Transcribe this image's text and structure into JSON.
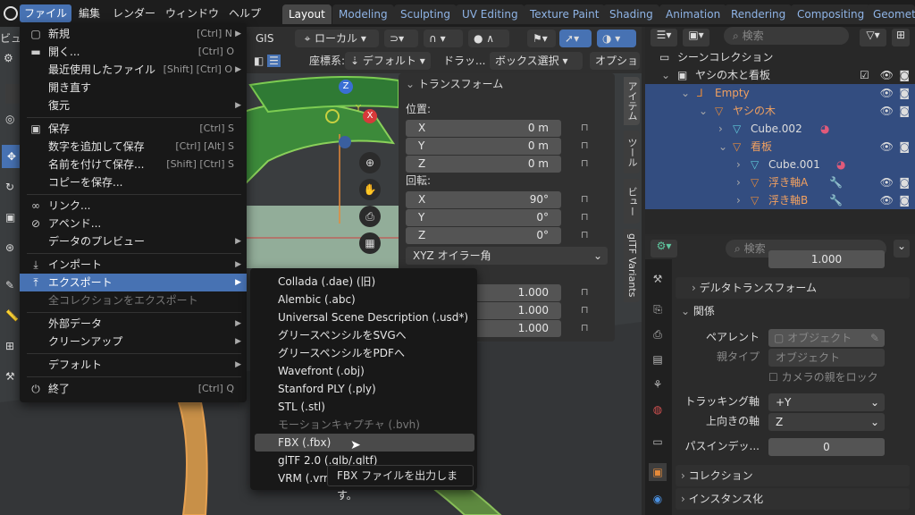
{
  "menubar": {
    "app_label": "",
    "items": [
      "ファイル",
      "編集",
      "レンダー",
      "ウィンドウ",
      "ヘルプ"
    ]
  },
  "workspaces": [
    "Layout",
    "Modeling",
    "Sculpting",
    "UV Editing",
    "Texture Paint",
    "Shading",
    "Animation",
    "Rendering",
    "Compositing",
    "Geometr"
  ],
  "viewport": {
    "header1": {
      "gis": "GIS",
      "orientation": "ローカル"
    },
    "header2": {
      "coord_label": "座標系:",
      "coord_value": "デフォルト",
      "drag_label": "ドラッ...",
      "select_mode": "ボックス選択",
      "options": "オプショ"
    },
    "left_label": "ビュ",
    "gizmo": {
      "z": "Z",
      "y": "Y",
      "x": "X"
    }
  },
  "npanel": {
    "title": "トランスフォーム",
    "location_label": "位置:",
    "location": [
      {
        "axis": "X",
        "value": "0 m"
      },
      {
        "axis": "Y",
        "value": "0 m"
      },
      {
        "axis": "Z",
        "value": "0 m"
      }
    ],
    "rotation_label": "回転:",
    "rotation": [
      {
        "axis": "X",
        "value": "90°"
      },
      {
        "axis": "Y",
        "value": "0°"
      },
      {
        "axis": "Z",
        "value": "0°"
      }
    ],
    "rotation_mode": "XYZ オイラー角",
    "scale": [
      "1.000",
      "1.000",
      "1.000"
    ],
    "tabs": [
      "アイテム",
      "ツール",
      "ビュー",
      "glTF Variants"
    ]
  },
  "file_menu": [
    {
      "label": "新規",
      "shortcut": "[Ctrl] N",
      "arrow": true
    },
    {
      "label": "開く...",
      "shortcut": "[Ctrl] O"
    },
    {
      "label": "最近使用したファイル",
      "shortcut": "[Shift] [Ctrl] O",
      "arrow": true
    },
    {
      "label": "開き直す",
      "shortcut": ""
    },
    {
      "label": "復元",
      "shortcut": "",
      "arrow": true
    },
    {
      "label": "保存",
      "shortcut": "[Ctrl] S"
    },
    {
      "label": "数字を追加して保存",
      "shortcut": "[Ctrl] [Alt] S"
    },
    {
      "label": "名前を付けて保存...",
      "shortcut": "[Shift] [Ctrl] S"
    },
    {
      "label": "コピーを保存...",
      "shortcut": ""
    },
    {
      "label": "リンク...",
      "shortcut": ""
    },
    {
      "label": "アペンド...",
      "shortcut": ""
    },
    {
      "label": "データのプレビュー",
      "shortcut": "",
      "arrow": true
    },
    {
      "label": "インポート",
      "shortcut": "",
      "arrow": true
    },
    {
      "label": "エクスポート",
      "shortcut": "",
      "arrow": true
    },
    {
      "label": "全コレクションをエクスポート",
      "shortcut": ""
    },
    {
      "label": "外部データ",
      "shortcut": "",
      "arrow": true
    },
    {
      "label": "クリーンアップ",
      "shortcut": "",
      "arrow": true
    },
    {
      "label": "デフォルト",
      "shortcut": "",
      "arrow": true
    },
    {
      "label": "終了",
      "shortcut": "[Ctrl] Q"
    }
  ],
  "export_menu": [
    "Collada (.dae) (旧)",
    "Alembic (.abc)",
    "Universal Scene Description (.usd*)",
    "グリースペンシルをSVGへ",
    "グリースペンシルをPDFへ",
    "Wavefront (.obj)",
    "Stanford PLY (.ply)",
    "STL (.stl)",
    "モーションキャプチャ (.bvh)",
    "FBX (.fbx)",
    "glTF 2.0 (.glb/.gltf)",
    "VRM (.vrm"
  ],
  "tooltip": "FBX ファイルを出力します。",
  "outliner": {
    "search_placeholder": "検索",
    "rows": [
      "シーンコレクション",
      "ヤシの木と看板",
      "Empty",
      "ヤシの木",
      "Cube.002",
      "看板",
      "Cube.001",
      "浮き軸A",
      "浮き軸B"
    ]
  },
  "properties": {
    "search_placeholder": "検索",
    "top_value": "1.000",
    "delta_transform": "デルタトランスフォーム",
    "relations": "関係",
    "parent_label": "ペアレント",
    "parent_placeholder": "オブジェクト",
    "parent_type_label": "親タイプ",
    "parent_type_value": "オブジェクト",
    "camera_lock": "カメラの親をロック",
    "track_label": "トラッキング軸",
    "track_value": "+Y",
    "up_label": "上向きの軸",
    "up_value": "Z",
    "pass_label": "パスインデッ...",
    "pass_value": "0",
    "collection": "コレクション",
    "instancing": "インスタンス化"
  },
  "colors": {
    "accent": "#4772b3",
    "selected_row": "#334d80",
    "object_orange": "#e58a3a",
    "mesh_cyan": "#5fc8d8"
  }
}
